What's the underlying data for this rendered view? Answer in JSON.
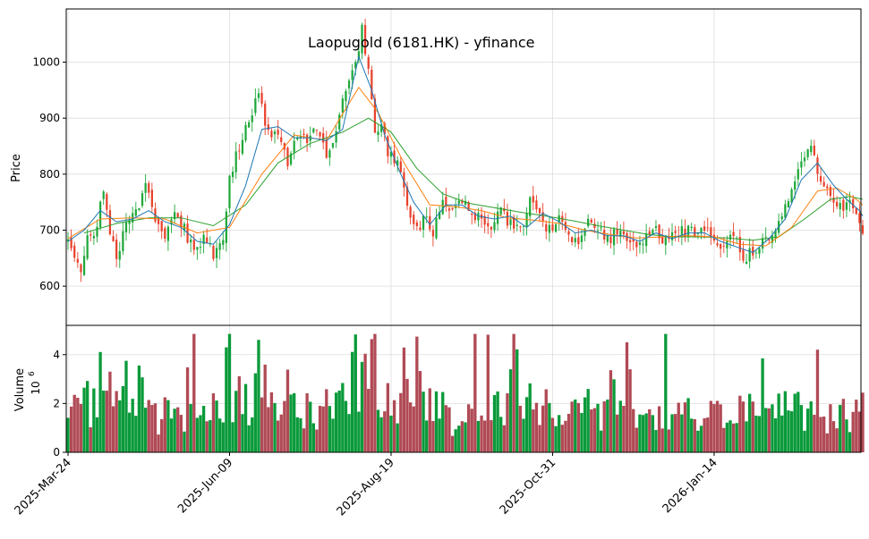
{
  "chart_data": {
    "type": "candlestick",
    "title": "Laopugold (6181.HK) - yfinance",
    "colors": {
      "up": "#1fa83a",
      "down": "#e8412b",
      "vol_up": "#0a9a3a",
      "vol_down": "#b04a55",
      "ma_fast": "#1f77b4",
      "ma_mid": "#ff7f0e",
      "ma_slow": "#2ca02c",
      "grid": "#dddddd"
    },
    "price_panel": {
      "ylabel": "Price",
      "ylim": [
        530,
        1095
      ],
      "yticks": [
        600,
        700,
        800,
        900,
        1000
      ],
      "grid": true
    },
    "volume_panel": {
      "ylabel": "Volume",
      "multiplier_label": "10",
      "multiplier_exp": "6",
      "ylim": [
        0,
        5.2
      ],
      "yticks": [
        0,
        2,
        4
      ],
      "grid": true
    },
    "x_axis": {
      "n_sessions": 247,
      "tick_labels": [
        "2025-Mar-24",
        "2025-Jun-09",
        "2025-Aug-19",
        "2025-Oct-31",
        "2026-Jan-14"
      ],
      "tick_index": [
        0,
        50,
        100,
        150,
        200
      ]
    },
    "close_path": [
      [
        0,
        680
      ],
      [
        4,
        625
      ],
      [
        6,
        690
      ],
      [
        9,
        700
      ],
      [
        11,
        780
      ],
      [
        13,
        700
      ],
      [
        15,
        640
      ],
      [
        18,
        720
      ],
      [
        21,
        730
      ],
      [
        24,
        790
      ],
      [
        27,
        720
      ],
      [
        30,
        690
      ],
      [
        33,
        740
      ],
      [
        36,
        700
      ],
      [
        39,
        660
      ],
      [
        42,
        685
      ],
      [
        45,
        660
      ],
      [
        48,
        690
      ],
      [
        50,
        790
      ],
      [
        53,
        850
      ],
      [
        56,
        900
      ],
      [
        59,
        940
      ],
      [
        62,
        870
      ],
      [
        65,
        880
      ],
      [
        68,
        820
      ],
      [
        71,
        870
      ],
      [
        74,
        860
      ],
      [
        77,
        885
      ],
      [
        80,
        840
      ],
      [
        83,
        870
      ],
      [
        86,
        950
      ],
      [
        89,
        1000
      ],
      [
        91,
        1060
      ],
      [
        93,
        980
      ],
      [
        95,
        870
      ],
      [
        97,
        880
      ],
      [
        99,
        840
      ],
      [
        102,
        820
      ],
      [
        104,
        780
      ],
      [
        106,
        730
      ],
      [
        108,
        700
      ],
      [
        110,
        720
      ],
      [
        113,
        700
      ],
      [
        116,
        760
      ],
      [
        119,
        740
      ],
      [
        122,
        750
      ],
      [
        125,
        730
      ],
      [
        128,
        720
      ],
      [
        131,
        710
      ],
      [
        134,
        730
      ],
      [
        137,
        715
      ],
      [
        140,
        700
      ],
      [
        143,
        750
      ],
      [
        146,
        720
      ],
      [
        149,
        700
      ],
      [
        152,
        720
      ],
      [
        155,
        690
      ],
      [
        158,
        680
      ],
      [
        161,
        710
      ],
      [
        164,
        700
      ],
      [
        167,
        680
      ],
      [
        170,
        700
      ],
      [
        173,
        690
      ],
      [
        176,
        670
      ],
      [
        179,
        690
      ],
      [
        182,
        700
      ],
      [
        185,
        680
      ],
      [
        188,
        690
      ],
      [
        191,
        700
      ],
      [
        194,
        695
      ],
      [
        197,
        700
      ],
      [
        200,
        680
      ],
      [
        203,
        670
      ],
      [
        206,
        690
      ],
      [
        209,
        650
      ],
      [
        212,
        665
      ],
      [
        215,
        680
      ],
      [
        218,
        700
      ],
      [
        221,
        720
      ],
      [
        224,
        780
      ],
      [
        227,
        820
      ],
      [
        230,
        840
      ],
      [
        233,
        790
      ],
      [
        236,
        760
      ],
      [
        239,
        745
      ],
      [
        242,
        750
      ],
      [
        244,
        720
      ],
      [
        246,
        700
      ]
    ],
    "ma_fast_path": [
      [
        0,
        680
      ],
      [
        5,
        700
      ],
      [
        10,
        735
      ],
      [
        15,
        715
      ],
      [
        20,
        720
      ],
      [
        25,
        735
      ],
      [
        30,
        715
      ],
      [
        35,
        705
      ],
      [
        40,
        680
      ],
      [
        45,
        675
      ],
      [
        50,
        710
      ],
      [
        55,
        780
      ],
      [
        60,
        880
      ],
      [
        65,
        885
      ],
      [
        70,
        865
      ],
      [
        75,
        865
      ],
      [
        80,
        860
      ],
      [
        85,
        880
      ],
      [
        90,
        1010
      ],
      [
        94,
        950
      ],
      [
        98,
        870
      ],
      [
        103,
        800
      ],
      [
        107,
        750
      ],
      [
        112,
        710
      ],
      [
        117,
        745
      ],
      [
        122,
        745
      ],
      [
        127,
        725
      ],
      [
        132,
        720
      ],
      [
        137,
        725
      ],
      [
        142,
        705
      ],
      [
        147,
        730
      ],
      [
        152,
        715
      ],
      [
        157,
        695
      ],
      [
        162,
        700
      ],
      [
        167,
        690
      ],
      [
        172,
        690
      ],
      [
        177,
        680
      ],
      [
        182,
        695
      ],
      [
        187,
        685
      ],
      [
        192,
        695
      ],
      [
        197,
        695
      ],
      [
        202,
        680
      ],
      [
        207,
        670
      ],
      [
        212,
        660
      ],
      [
        217,
        685
      ],
      [
        222,
        720
      ],
      [
        227,
        790
      ],
      [
        232,
        820
      ],
      [
        237,
        780
      ],
      [
        241,
        755
      ],
      [
        245,
        735
      ],
      [
        246,
        725
      ]
    ],
    "ma_mid_path": [
      [
        0,
        685
      ],
      [
        10,
        720
      ],
      [
        20,
        722
      ],
      [
        30,
        720
      ],
      [
        40,
        695
      ],
      [
        50,
        705
      ],
      [
        60,
        800
      ],
      [
        70,
        870
      ],
      [
        80,
        860
      ],
      [
        90,
        955
      ],
      [
        96,
        910
      ],
      [
        104,
        820
      ],
      [
        112,
        745
      ],
      [
        120,
        742
      ],
      [
        128,
        735
      ],
      [
        136,
        722
      ],
      [
        144,
        718
      ],
      [
        152,
        712
      ],
      [
        160,
        700
      ],
      [
        168,
        692
      ],
      [
        176,
        686
      ],
      [
        184,
        688
      ],
      [
        192,
        690
      ],
      [
        200,
        688
      ],
      [
        208,
        675
      ],
      [
        216,
        672
      ],
      [
        224,
        705
      ],
      [
        232,
        770
      ],
      [
        238,
        775
      ],
      [
        244,
        755
      ],
      [
        246,
        745
      ]
    ],
    "ma_slow_path": [
      [
        5,
        695
      ],
      [
        15,
        712
      ],
      [
        25,
        722
      ],
      [
        35,
        722
      ],
      [
        45,
        708
      ],
      [
        55,
        745
      ],
      [
        65,
        820
      ],
      [
        75,
        855
      ],
      [
        85,
        875
      ],
      [
        93,
        900
      ],
      [
        100,
        875
      ],
      [
        108,
        810
      ],
      [
        116,
        765
      ],
      [
        124,
        748
      ],
      [
        132,
        740
      ],
      [
        140,
        732
      ],
      [
        148,
        725
      ],
      [
        156,
        717
      ],
      [
        164,
        708
      ],
      [
        172,
        700
      ],
      [
        180,
        692
      ],
      [
        188,
        688
      ],
      [
        196,
        688
      ],
      [
        204,
        686
      ],
      [
        212,
        682
      ],
      [
        220,
        688
      ],
      [
        228,
        720
      ],
      [
        236,
        755
      ],
      [
        242,
        760
      ],
      [
        246,
        755
      ]
    ]
  }
}
